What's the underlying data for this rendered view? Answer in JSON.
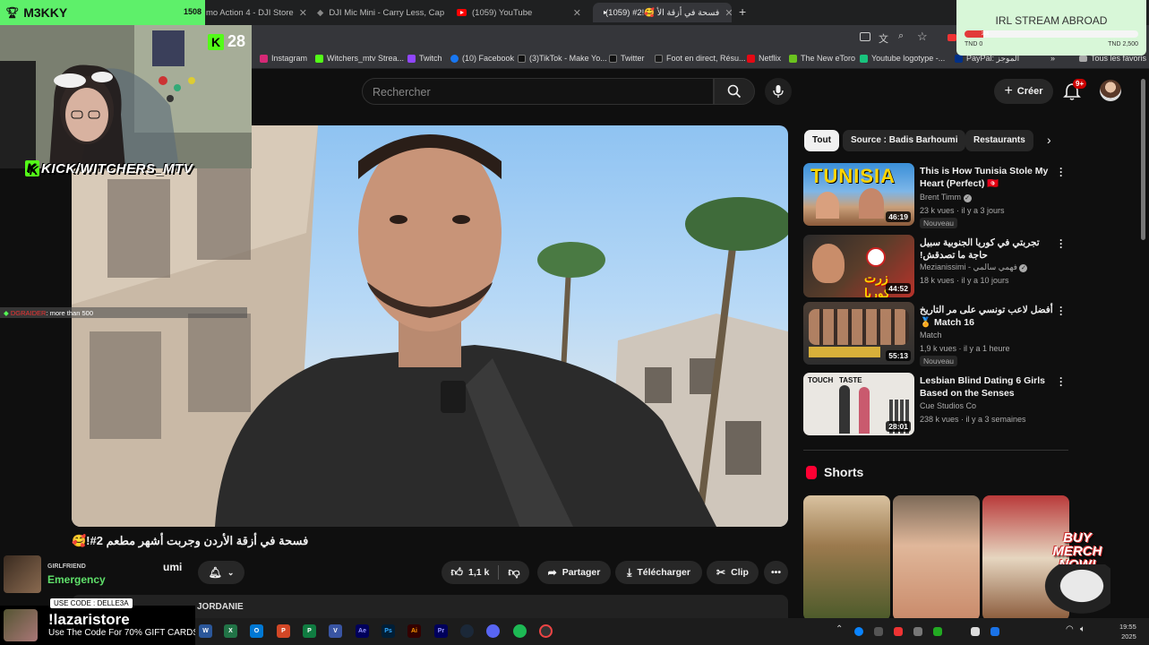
{
  "browser": {
    "tabs": [
      {
        "label": "mo Action 4 - DJI Store",
        "active": false
      },
      {
        "label": "DJI Mic Mini - Carry Less, Capt",
        "active": false
      },
      {
        "label": "(1059) YouTube",
        "active": false
      },
      {
        "label": "(1059) ‪#2!🥰 فسحة في أزقة الأ",
        "active": true
      }
    ],
    "new_tab": "+",
    "bookmarks": [
      {
        "label": "Instagram",
        "color": "#d62976"
      },
      {
        "label": "Witchers_mtv Strea...",
        "color": "#53fc18"
      },
      {
        "label": "Twitch",
        "color": "#9146ff"
      },
      {
        "label": "(10) Facebook",
        "color": "#1877f2"
      },
      {
        "label": "(3)TikTok - Make Yo...",
        "color": "#111111"
      },
      {
        "label": "Twitter",
        "color": "#111111"
      },
      {
        "label": "Foot en direct, Résu...",
        "color": "#1a1a1a"
      },
      {
        "label": "Netflix",
        "color": "#e50914"
      },
      {
        "label": "The New eToro",
        "color": "#6bc31f"
      },
      {
        "label": "Youtube logotype -...",
        "color": "#19c37d"
      },
      {
        "label": "PayPal: الموجز",
        "color": "#003087"
      }
    ],
    "all_bookmarks": "Tous les favoris"
  },
  "youtube": {
    "search_placeholder": "Rechercher",
    "create_label": "Créer",
    "notif_count": "9+",
    "video_title": "فسحة في أزقة الأردن وجربت أشهر مطعم 2#!🥰",
    "channel_name": "umi",
    "actions": {
      "likes": "1,1 k",
      "share": "Partager",
      "download": "Télécharger",
      "clip": "Clip"
    },
    "description_snippet": "JORDANIE",
    "chips": [
      {
        "label": "Tout",
        "selected": true
      },
      {
        "label": "Source : Badis Barhoumi",
        "selected": false
      },
      {
        "label": "Restaurants",
        "selected": false
      }
    ],
    "recommendations": [
      {
        "title": "This is How Tunisia Stole My Heart (Perfect) 🇹🇳",
        "channel": "Brent Timm",
        "verified": true,
        "meta": "23 k vues · il y a 3 jours",
        "badge": "Nouveau",
        "duration": "46:19",
        "thumb_text": "TUNISIA"
      },
      {
        "title": "تجربتي في كوريا الجنوبية سبيل حاجة ما تصدقش!",
        "channel": "Mezianissimi - فهمي سالمي",
        "verified": true,
        "meta": "18 k vues · il y a 10 jours",
        "badge": "",
        "duration": "44:52",
        "thumb_text": "زرت كوريا"
      },
      {
        "title": "أفضل لاعب تونسي على مر التاريخ 🏅 Match 16",
        "channel": "Match",
        "verified": false,
        "meta": "1,9 k vues · il y a 1 heure",
        "badge": "Nouveau",
        "duration": "55:13",
        "thumb_text": ""
      },
      {
        "title": "Lesbian Blind Dating 6 Girls Based on the Senses",
        "channel": "Cue Studios Co",
        "verified": false,
        "meta": "238 k vues · il y a 3 semaines",
        "badge": "",
        "duration": "28:01",
        "thumb_text": "TOUCH   TASTE"
      }
    ],
    "shorts_label": "Shorts"
  },
  "overlay": {
    "streamer": "M3KKY",
    "streamer_points": "1508",
    "kick_viewers": "28",
    "kick_handle": "KICK/WITCHERS_MTV",
    "chat_user": "DGRAIDER",
    "chat_message": ": more than 500",
    "goal_title": "IRL STREAM ABROAD",
    "goal_min": "TND 0",
    "goal_max": "TND 2,500",
    "goal_current": "265",
    "goal_fraction": 0.106,
    "gf_label": "GIRLFRIEND",
    "gf_song": "Emergency",
    "promo_code": "USE CODE : DELLE3A",
    "promo_store": "!lazaristore",
    "promo_sub": "Use The Code For 70% GIFT CARDS",
    "merch": "BUY MERCH NOW!"
  },
  "taskbar": {
    "apps": [
      "W",
      "X",
      "O",
      "P",
      "P",
      "V",
      "Ae",
      "Ps",
      "Ai",
      "Pr"
    ],
    "time": "19:55",
    "date": "2025"
  }
}
